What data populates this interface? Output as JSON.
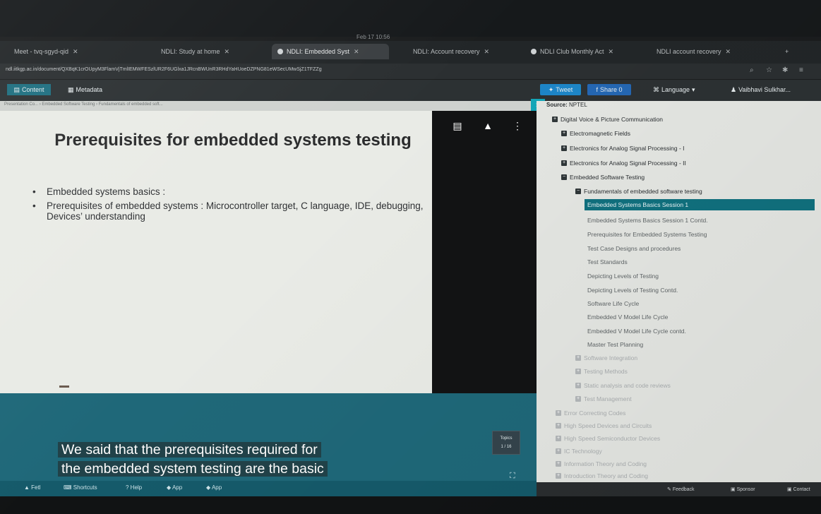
{
  "clock": "Feb 17 10:56",
  "tabs": [
    {
      "label": "Meet - tvq-sgyd-qid"
    },
    {
      "label": "NDLI: Study at home"
    },
    {
      "label": "NDLI: Embedded Syst",
      "active": true
    },
    {
      "label": "NDLI: Account recovery"
    },
    {
      "label": "NDLI Club Monthly Act"
    },
    {
      "label": "NDLI account recovery"
    }
  ],
  "url": "ndl.iitkgp.ac.in/document/QXBqK1crOUpyM3FlamVjTmlIEMWFESzlUR2F6UGlxa1JRcnBWUnR3RHdYaHUoeDZPNG81eWSecUMwSjZ1TFZZg",
  "toolbar": {
    "content_tab": "Content",
    "metadata_tab": "Metadata",
    "tweet": "Tweet",
    "share": "Share 0",
    "language": "Language",
    "user": "Vaibhavi Sulkhar..."
  },
  "breadcrumb": "Presentation Co...  ›  Embedded Software Testing  ›  Fundamentals of embedded soft...",
  "slide": {
    "title": "Prerequisites for embedded systems testing",
    "bullets": [
      "Embedded systems basics :",
      "Prerequisites of embedded systems : Microcontroller target, C language, IDE, debugging, Devices’ understanding"
    ]
  },
  "caption": {
    "line1": "We said that the prerequisites required for",
    "line2": "the embedded system testing are the basic"
  },
  "topics_badge": {
    "label": "Topics",
    "value": "1 / 16"
  },
  "bottom_bar": [
    "Fetl",
    "Shortcuts",
    "Help",
    "App",
    "App"
  ],
  "right_panel": {
    "source_label": "Source:",
    "source_value": "NPTEL",
    "top_items": [
      "Digital Voice & Picture Communication",
      "Electromagnetic Fields",
      "Electronics for Analog Signal Processing - I",
      "Electronics for Analog Signal Processing - II",
      "Embedded Software Testing"
    ],
    "expanded_item": "Fundamentals of embedded software testing",
    "sub_items": [
      "Embedded Systems Basics Session 1",
      "Embedded Systems Basics Session 1 Contd.",
      "Prerequisites for Embedded Systems Testing",
      "Test Case Designs and procedures",
      "Test Standards",
      "Depicting Levels of Testing",
      "Depicting Levels of Testing Contd.",
      "Software Life Cycle",
      "Embedded V Model Life Cycle",
      "Embedded V Model Life Cycle contd.",
      "Master Test Planning"
    ],
    "sibling_items": [
      "Software Integration",
      "Testing Methods",
      "Static analysis and code reviews",
      "Test Management"
    ],
    "more_items": [
      "Error Correcting Codes",
      "High Speed Devices and Circuits",
      "High Speed Semiconductor Devices",
      "IC Technology",
      "Information Theory and Coding",
      "Introduction Theory and Coding"
    ],
    "footer": [
      "Feedback",
      "Sponsor",
      "Contact"
    ]
  }
}
